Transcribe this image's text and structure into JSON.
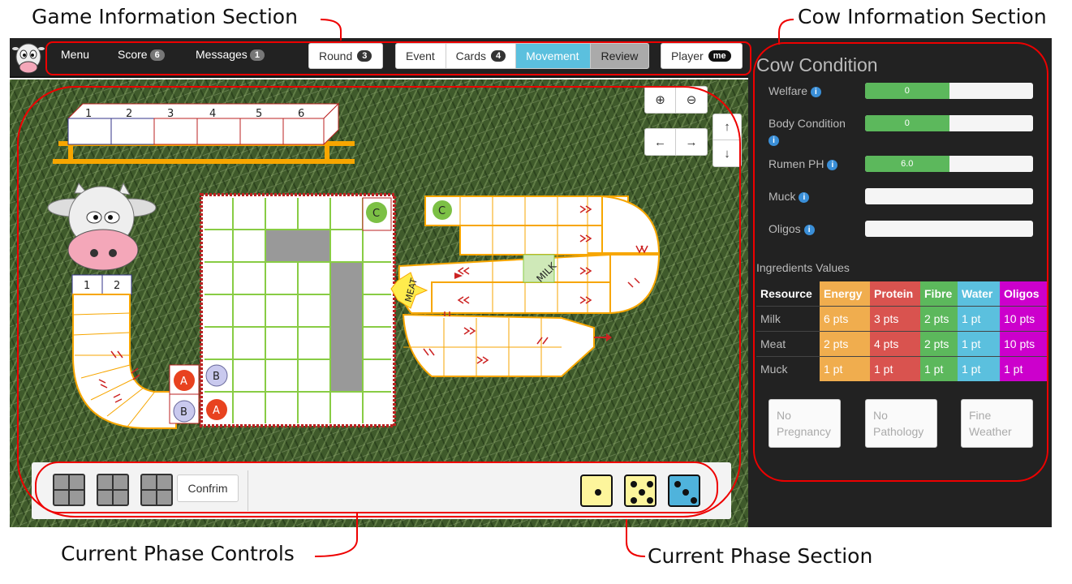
{
  "annotations": {
    "game_info": "Game Information Section",
    "cow_info": "Cow Information Section",
    "phase_controls": "Current Phase Controls",
    "phase_section": "Current Phase Section"
  },
  "nav": {
    "menu": "Menu",
    "score_label": "Score",
    "score_count": "6",
    "messages_label": "Messages",
    "messages_count": "1",
    "round_label": "Round",
    "round_value": "3",
    "phases": {
      "event": "Event",
      "cards": "Cards",
      "cards_count": "4",
      "movement": "Movement",
      "review": "Review"
    },
    "player_label": "Player",
    "player_value": "me"
  },
  "board": {
    "rumen_numbers": [
      "1",
      "2",
      "3",
      "4",
      "5",
      "6"
    ],
    "stomach_numbers": [
      "1",
      "2"
    ],
    "labels": {
      "a1": "A",
      "b1": "B",
      "b2": "B",
      "a2": "A",
      "c1": "C",
      "c2": "C",
      "milk": "MILK",
      "meat": "MEAT"
    }
  },
  "controls": {
    "confirm_label": "Confrim",
    "dice": [
      {
        "value": 1,
        "color": "#fdf59c"
      },
      {
        "value": 5,
        "color": "#fdf59c"
      },
      {
        "value": 3,
        "color": "#4fb3dc"
      }
    ]
  },
  "cow": {
    "title": "Cow Condition",
    "stats": [
      {
        "label": "Welfare",
        "value": "0",
        "fill": 0.5
      },
      {
        "label": "Body Condition",
        "value": "0",
        "fill": 0.5
      },
      {
        "label": "Rumen PH",
        "value": "6.0",
        "fill": 0.5
      },
      {
        "label": "Muck",
        "value": "",
        "fill": 0
      },
      {
        "label": "Oligos",
        "value": "",
        "fill": 0
      }
    ],
    "ingredients_title": "Ingredients Values",
    "table": {
      "headers": [
        "Resource",
        "Energy",
        "Protein",
        "Fibre",
        "Water",
        "Oligos"
      ],
      "header_colors": [
        "#222222",
        "#f0ad4e",
        "#d9534f",
        "#5cb85c",
        "#5bc0de",
        "#cc00cc"
      ],
      "rows": [
        [
          "Milk",
          "6 pts",
          "3 pts",
          "2 pts",
          "1 pt",
          "10 pts"
        ],
        [
          "Meat",
          "2 pts",
          "4 pts",
          "2 pts",
          "1 pt",
          "10 pts"
        ],
        [
          "Muck",
          "1 pt",
          "1 pt",
          "1 pt",
          "1 pt",
          "1 pt"
        ]
      ]
    },
    "status": [
      "No Pregnancy",
      "No Pathology",
      "Fine Weather"
    ]
  }
}
